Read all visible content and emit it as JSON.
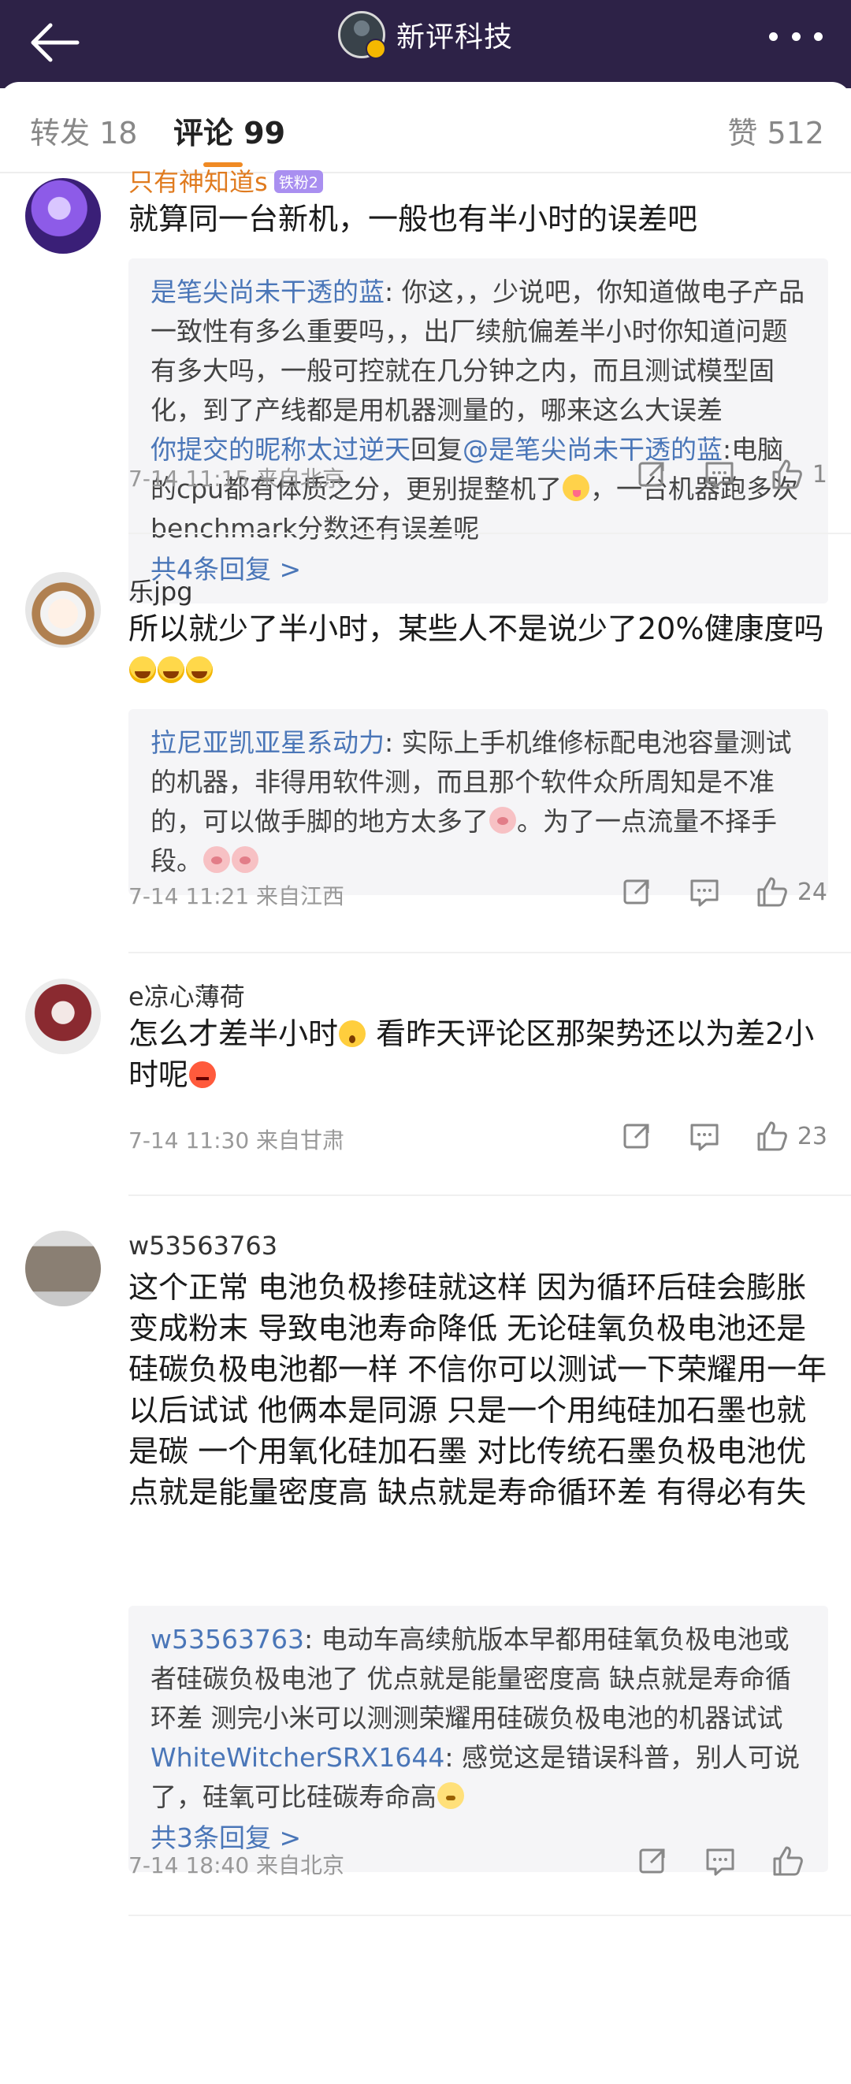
{
  "header": {
    "account_name": "新评科技",
    "back_icon": "arrow-left-icon",
    "more_icon": "ellipsis-icon"
  },
  "tabs": {
    "repost": "转发 18",
    "comments": "评论 99",
    "likes": "赞 512"
  },
  "colors": {
    "header_bg": "#2d2247",
    "tab_indicator": "#f08a24",
    "link": "#4a76b8",
    "quote_bg": "#f5f5f7"
  },
  "comments": [
    {
      "user": "只有神知道s",
      "badge": "铁粉2",
      "text": "就算同一台新机，一般也有半小时的误差吧",
      "replies": [
        {
          "user": "是笔尖尚未干透的蓝",
          "sep": ":",
          "text": " 你这，，少说吧，你知道做电子产品一致性有多么重要吗，，出厂续航偏差半小时你知道问题有多大吗，一般可控就在几分钟之内，而且测试模型固化，到了产线都是用机器测量的，哪来这么大误差"
        },
        {
          "user": "你提交的昵称太过逆天",
          "mid": "回复",
          "user2": "@是笔尖尚未干透的蓝",
          "sep": ":",
          "text": "电脑的cpu都有体质之分，更别提整机了",
          "text_after": "，一台机器跑多次benchmark分数还有误差呢"
        }
      ],
      "more_replies": "共4条回复 >",
      "time": "7-14 11:15",
      "location": "来自北京",
      "likes": "1"
    },
    {
      "user": "乐jpg",
      "text": "所以就少了半小时，某些人不是说少了20%健康度吗",
      "replies": [
        {
          "user": "拉尼亚凯亚星系动力",
          "sep": ":",
          "text": " 实际上手机维修标配电池容量测试的机器，非得用软件测，而且那个软件众所周知是不准的，可以做手脚的地方太多了",
          "text_after": "。为了一点流量不择手段。"
        }
      ],
      "time": "7-14 11:21",
      "location": "来自江西",
      "likes": "24"
    },
    {
      "user": "e凉心薄荷",
      "text": "怎么才差半小时",
      "text_mid": " 看昨天评论区那架势还以为差2小时呢",
      "time": "7-14 11:30",
      "location": "来自甘肃",
      "likes": "23"
    },
    {
      "user": "w53563763",
      "text": "这个正常 电池负极掺硅就这样 因为循环后硅会膨胀变成粉末 导致电池寿命降低 无论硅氧负极电池还是硅碳负极电池都一样 不信你可以测试一下荣耀用一年以后试试 他俩本是同源 只是一个用纯硅加石墨也就是碳 一个用氧化硅加石墨 对比传统石墨负极电池优点就是能量密度高 缺点就是寿命循环差 有得必有失",
      "replies": [
        {
          "user": "w53563763",
          "sep": ":",
          "text": " 电动车高续航版本早都用硅氧负极电池或者硅碳负极电池了 优点就是能量密度高 缺点就是寿命循环差 测完小米可以测测荣耀用硅碳负极电池的机器试试"
        },
        {
          "user": "WhiteWitcherSRX1644",
          "sep": ":",
          "text": " 感觉这是错误科普，别人可说了，硅氧可比硅碳寿命高"
        }
      ],
      "more_replies": "共3条回复 >",
      "time": "7-14 18:40",
      "location": "来自北京",
      "likes": ""
    }
  ]
}
